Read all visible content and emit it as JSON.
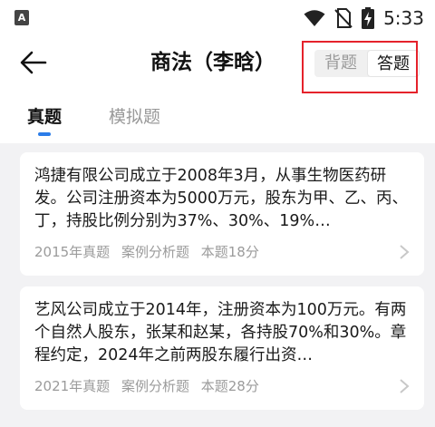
{
  "status_bar": {
    "app_badge": "A",
    "time": "5:33",
    "icons": [
      "wifi-icon",
      "no-sim-icon",
      "battery-charging-icon"
    ]
  },
  "app_bar": {
    "back_icon": "arrow-left-icon",
    "title": "商法（李晗）",
    "mode_toggle": {
      "options": [
        "背题",
        "答题"
      ],
      "selected": "答题"
    }
  },
  "tabs": [
    {
      "label": "真题",
      "active": true
    },
    {
      "label": "模拟题",
      "active": false
    }
  ],
  "questions": [
    {
      "text": "鸿捷有限公司成立于2008年3月，从事生物医药研发。公司注册资本为5000万元，股东为甲、乙、丙、丁，持股比例分别为37%、30%、19%…",
      "year": "2015年真题",
      "type": "案例分析题",
      "score": "本题18分"
    },
    {
      "text": "艺风公司成立于2014年，注册资本为100万元。有两个自然人股东，张某和赵某，各持股70%和30%。章程约定，2024年之前两股东履行出资…",
      "year": "2021年真题",
      "type": "案例分析题",
      "score": "本题28分"
    }
  ],
  "colors": {
    "accent": "#2b7de9",
    "highlight_box": "#e5222b",
    "background": "#f2f2f4"
  }
}
